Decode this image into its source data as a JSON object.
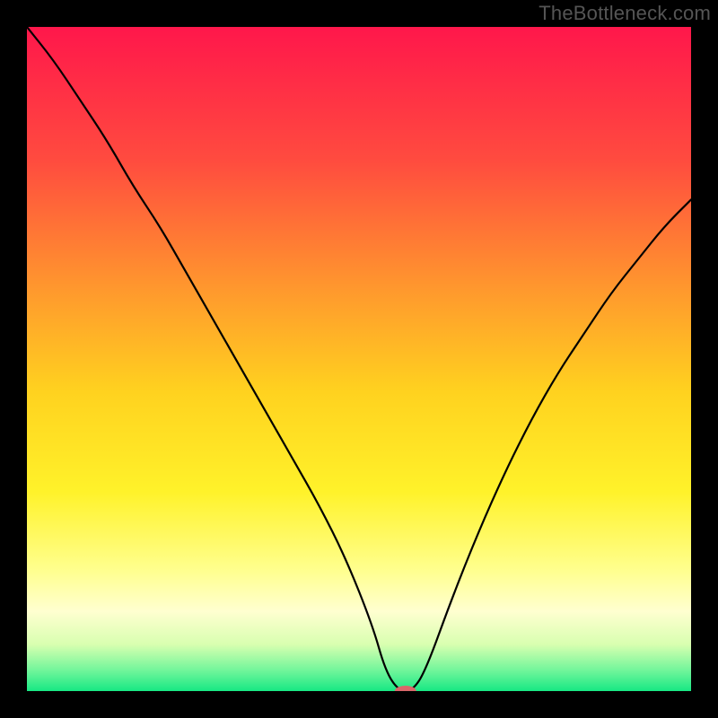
{
  "attribution": "TheBottleneck.com",
  "chart_data": {
    "type": "line",
    "title": "",
    "xlabel": "",
    "ylabel": "",
    "xlim": [
      0,
      100
    ],
    "ylim": [
      0,
      100
    ],
    "grid": false,
    "background_gradient": {
      "stops": [
        {
          "offset": 0.0,
          "color": "#ff174b"
        },
        {
          "offset": 0.2,
          "color": "#ff4b3f"
        },
        {
          "offset": 0.4,
          "color": "#ff9a2d"
        },
        {
          "offset": 0.55,
          "color": "#ffd21f"
        },
        {
          "offset": 0.7,
          "color": "#fff22a"
        },
        {
          "offset": 0.82,
          "color": "#ffff90"
        },
        {
          "offset": 0.88,
          "color": "#ffffd0"
        },
        {
          "offset": 0.93,
          "color": "#d8ffb0"
        },
        {
          "offset": 0.97,
          "color": "#6ef59a"
        },
        {
          "offset": 1.0,
          "color": "#17e884"
        }
      ]
    },
    "series": [
      {
        "name": "bottleneck-curve",
        "color": "#000000",
        "x": [
          0,
          4,
          8,
          12,
          16,
          20,
          24,
          28,
          32,
          36,
          40,
          44,
          48,
          52,
          54,
          56,
          58,
          60,
          64,
          68,
          72,
          76,
          80,
          84,
          88,
          92,
          96,
          100
        ],
        "y": [
          100,
          95,
          89,
          83,
          76,
          70,
          63,
          56,
          49,
          42,
          35,
          28,
          20,
          10,
          3,
          0,
          0,
          3,
          14,
          24,
          33,
          41,
          48,
          54,
          60,
          65,
          70,
          74
        ]
      }
    ],
    "marker": {
      "name": "optimal-point",
      "x": 57,
      "y": 0,
      "color": "#d9676a",
      "rx": 12,
      "ry": 6
    }
  }
}
